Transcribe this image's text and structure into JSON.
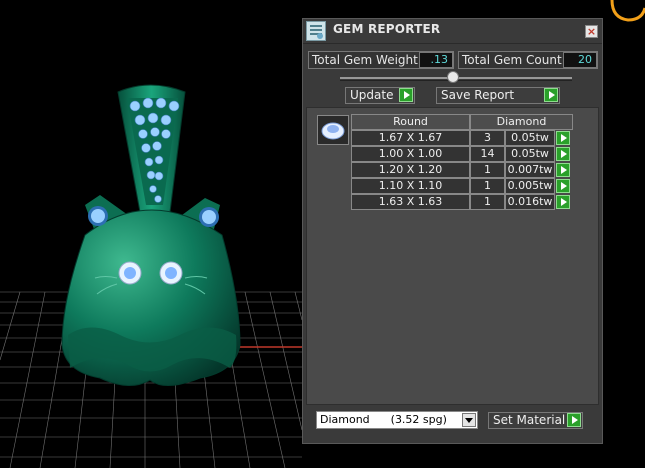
{
  "viewport": {
    "grid_color": "#cfcfcf",
    "axis_color": "#c0392b",
    "model_color": "#0e7a5c",
    "gem_color": "#9ad0ff",
    "corner_widget_color": "#f2a019"
  },
  "panel": {
    "title": "GEM REPORTER",
    "app_icon": "report-icon",
    "close_glyph": "×",
    "total_weight": {
      "label": "Total Gem Weight",
      "value": ".13"
    },
    "total_count": {
      "label": "Total Gem Count",
      "value": "20"
    },
    "slider_level": 0.5,
    "update_label": "Update",
    "save_report_label": "Save Report",
    "table": {
      "headers": [
        "Round",
        "Diamond"
      ],
      "gem_icon": "round-gem-icon",
      "rows": [
        {
          "size": "1.67 X 1.67",
          "count": "3",
          "weight": "0.05tw"
        },
        {
          "size": "1.00 X 1.00",
          "count": "14",
          "weight": "0.05tw"
        },
        {
          "size": "1.20 X 1.20",
          "count": "1",
          "weight": "0.007tw"
        },
        {
          "size": "1.10 X 1.10",
          "count": "1",
          "weight": "0.005tw"
        },
        {
          "size": "1.63 X 1.63",
          "count": "1",
          "weight": "0.016tw"
        }
      ]
    },
    "material": {
      "selected": "Diamond      (3.52 spg)"
    },
    "set_material_label": "Set Material"
  }
}
